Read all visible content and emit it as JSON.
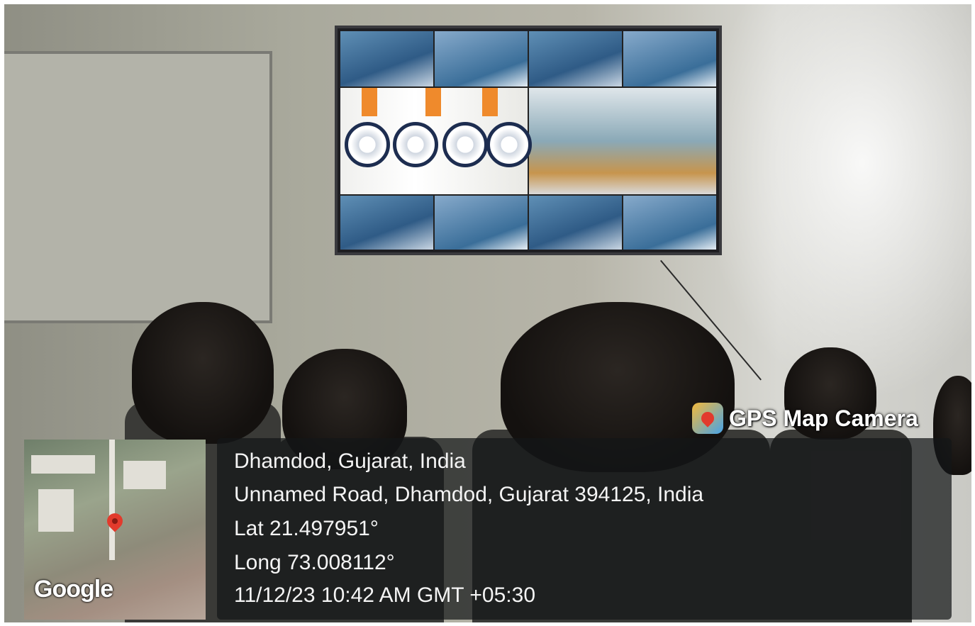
{
  "overlay": {
    "brand": "GPS Map Camera",
    "brand_icon": "map-pin-icon",
    "place": "Dhamdod, Gujarat, India",
    "address": "Unnamed Road, Dhamdod, Gujarat 394125, India",
    "lat": "Lat 21.497951°",
    "long": "Long 73.008112°",
    "datetime": "11/12/23 10:42 AM GMT +05:30",
    "map_logo": "Google"
  },
  "colors": {
    "pin": "#e23a2c",
    "panel_bg": "#141618",
    "text": "#f4f4f4"
  }
}
